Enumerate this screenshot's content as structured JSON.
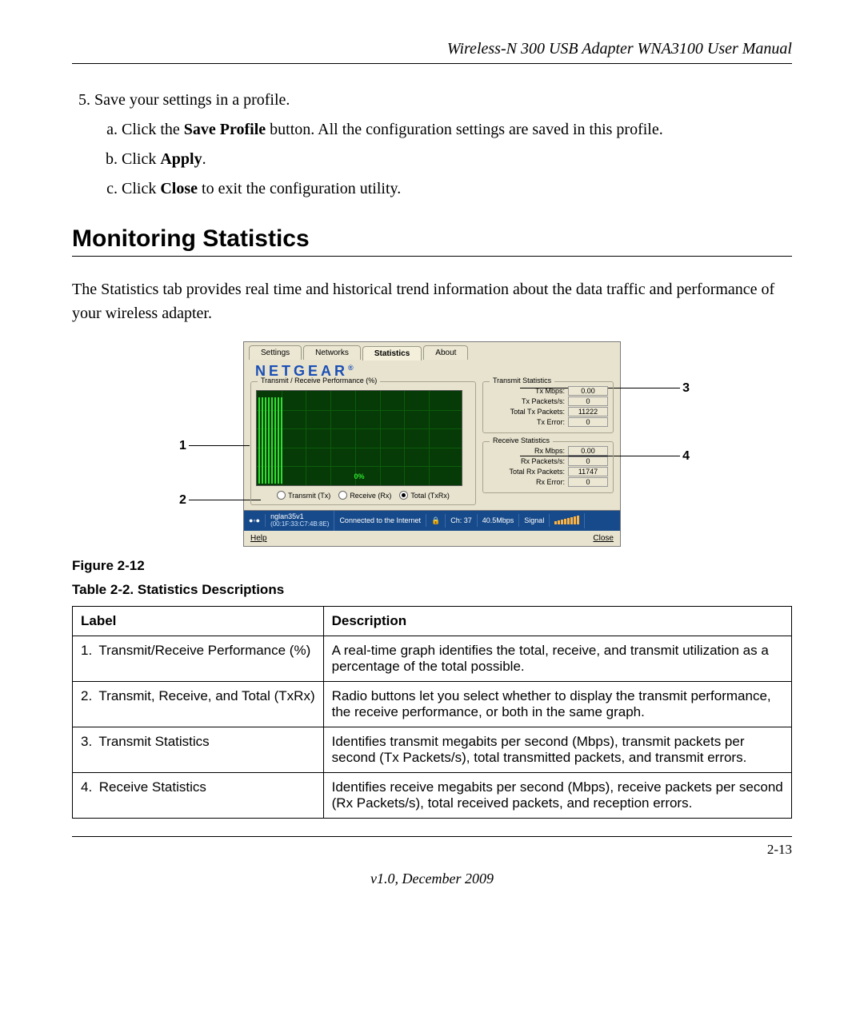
{
  "running_head": "Wireless-N 300 USB Adapter WNA3100 User Manual",
  "step5": {
    "number": "5.",
    "text": "Save your settings in a profile.",
    "substeps": {
      "a": {
        "prefix": "Click the ",
        "bold": "Save Profile",
        "suffix": " button. All the configuration settings are saved in this profile."
      },
      "b": {
        "prefix": "Click ",
        "bold": "Apply",
        "suffix": "."
      },
      "c": {
        "prefix": "Click ",
        "bold": "Close",
        "suffix": " to exit the configuration utility."
      }
    }
  },
  "section_heading": "Monitoring Statistics",
  "intro_para": "The Statistics tab provides real time and historical trend information about the data traffic and performance of your wireless adapter.",
  "app": {
    "tabs": [
      "Settings",
      "Networks",
      "Statistics",
      "About"
    ],
    "active_tab_index": 2,
    "brand": "NETGEAR",
    "graph_panel_title": "Transmit / Receive Performance (%)",
    "graph_zero": "0%",
    "radios": {
      "tx": "Transmit (Tx)",
      "rx": "Receive (Rx)",
      "total": "Total (TxRx)"
    },
    "tx_panel_title": "Transmit Statistics",
    "rx_panel_title": "Receive Statistics",
    "tx_stats": {
      "mbps_label": "Tx Mbps:",
      "mbps_val": "0.00",
      "pkts_label": "Tx Packets/s:",
      "pkts_val": "0",
      "total_label": "Total Tx Packets:",
      "total_val": "11222",
      "err_label": "Tx Error:",
      "err_val": "0"
    },
    "rx_stats": {
      "mbps_label": "Rx Mbps:",
      "mbps_val": "0.00",
      "pkts_label": "Rx Packets/s:",
      "pkts_val": "0",
      "total_label": "Total Rx Packets:",
      "total_val": "11747",
      "err_label": "Rx Error:",
      "err_val": "0"
    },
    "status": {
      "ssid": "nglan35v1",
      "mac": "(00:1F:33:C7:4B:8E)",
      "conn": "Connected to the Internet",
      "channel": "Ch: 37",
      "rate": "40.5Mbps",
      "signal_label": "Signal"
    },
    "footer": {
      "help": "Help",
      "close": "Close"
    }
  },
  "callouts": {
    "c1": "1",
    "c2": "2",
    "c3": "3",
    "c4": "4"
  },
  "figure_caption": "Figure 2-12",
  "table_caption": "Table 2-2.  Statistics Descriptions",
  "table": {
    "headers": {
      "label": "Label",
      "desc": "Description"
    },
    "rows": [
      {
        "n": "1.",
        "label": "Transmit/Receive Performance (%)",
        "desc": "A real-time graph identifies the total, receive, and transmit utilization as a percentage of the total possible."
      },
      {
        "n": "2.",
        "label": "Transmit, Receive, and Total (TxRx)",
        "desc": "Radio buttons let you select whether to display the transmit performance, the receive performance, or both in the same graph."
      },
      {
        "n": "3.",
        "label": "Transmit Statistics",
        "desc": "Identifies transmit megabits per second (Mbps), transmit packets per second (Tx Packets/s), total transmitted packets, and transmit errors."
      },
      {
        "n": "4.",
        "label": "Receive Statistics",
        "desc": "Identifies receive megabits per second (Mbps), receive packets per second (Rx Packets/s), total received packets, and reception errors."
      }
    ]
  },
  "page_number": "2-13",
  "version_line": "v1.0, December 2009"
}
